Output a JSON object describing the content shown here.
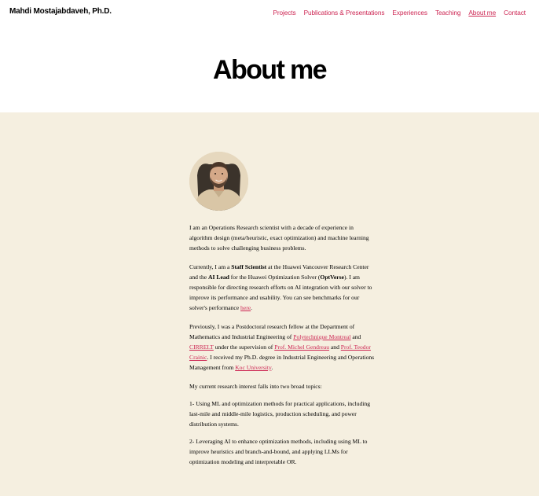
{
  "site": {
    "title": "Mahdi Mostajabdaveh, Ph.D."
  },
  "nav": {
    "items": [
      {
        "label": "Projects"
      },
      {
        "label": "Publications & Presentations"
      },
      {
        "label": "Experiences"
      },
      {
        "label": "Teaching"
      },
      {
        "label": "About me"
      },
      {
        "label": "Contact"
      }
    ],
    "active": "About me"
  },
  "page": {
    "title": "About me"
  },
  "colors": {
    "accent": "#cd2653",
    "content_bg": "#f5efe0"
  },
  "avatar": {
    "alt": "profile-photo"
  },
  "bio": {
    "p1": "I am an Operations Research scientist with a decade of experience in algorithm design (meta/heuristic, exact optimization) and machine learning methods to solve challenging business problems.",
    "p2": {
      "t1": "Currently, I am a ",
      "b1": "Staff Scientist",
      "t2": " at the Huawei Vancouver Research Center and the ",
      "b2": "AI Lead",
      "t3": " for the Huawei Optimization Solver (",
      "b3": "OptVerse",
      "t4": "). I am responsible for directing research efforts on AI integration with our solver to improve its performance and usability. You can see benchmarks for our solver's performance ",
      "link": "here",
      "t5": "."
    },
    "p3": {
      "t1": "Previously, I was a Postdoctoral research fellow at the Department of Mathematics and Industrial Engineering of ",
      "l1": "Polytechnique Montreal",
      "t2": " and ",
      "l2": "CIRRELT",
      "t3": " under the supervision of ",
      "l3": "Prof. Michel Gendreau",
      "t4": " and ",
      "l4": "Prof. Teodor Crainic",
      "t5": ". I received my Ph.D. degree in Industrial Engineering and Operations Management from ",
      "l5": "Koc University",
      "t6": "."
    },
    "p4": "My current research interest falls into two broad topics:",
    "p5": "1- Using ML and optimization methods for practical applications, including last-mile and middle-mile logistics, production scheduling, and power distribution systems.",
    "p6": "2- Leveraging AI to enhance optimization methods, including using ML to improve heuristics and branch-and-bound, and applying LLMs for optimization modeling and interpretable OR."
  }
}
